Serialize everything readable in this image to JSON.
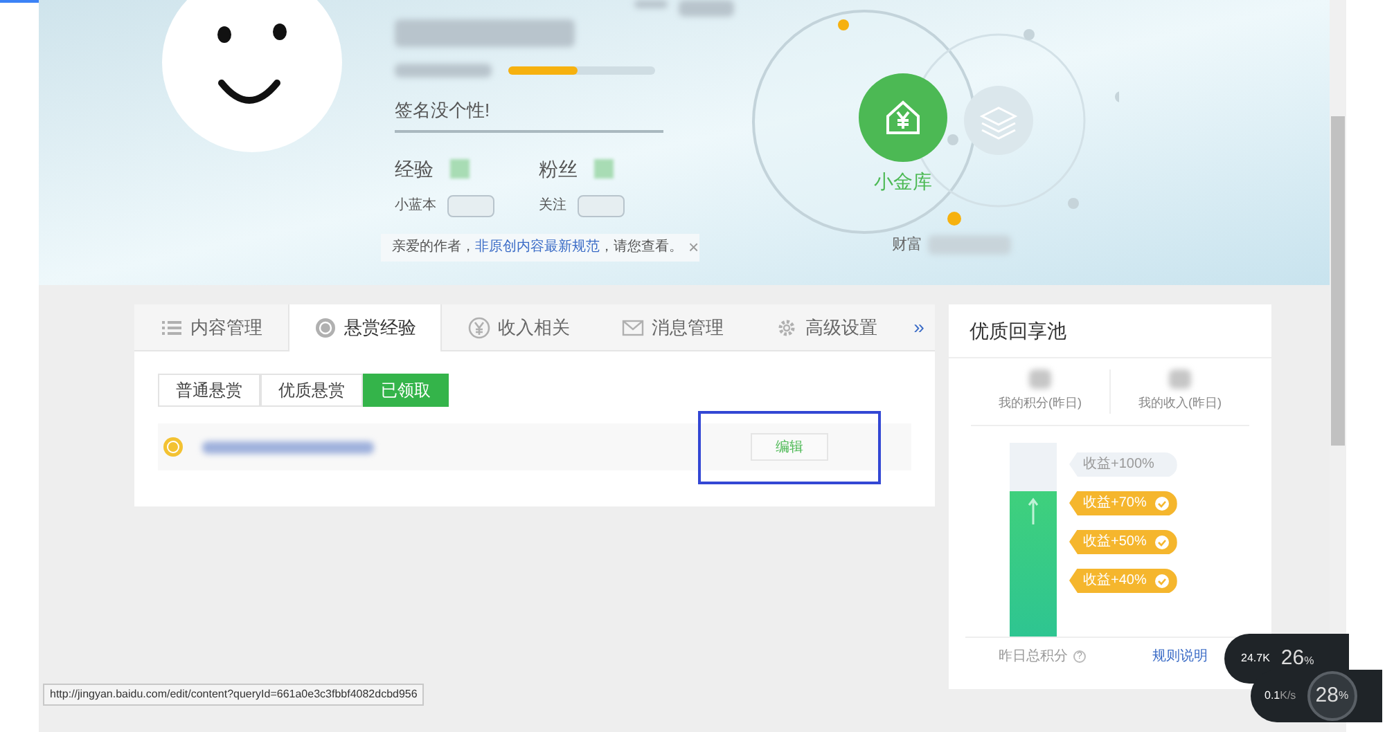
{
  "profile": {
    "signature": "签名没个性!",
    "level_progress": {
      "level": 0.47
    },
    "stats": [
      {
        "label": "经验"
      },
      {
        "label": "粉丝"
      }
    ],
    "sub_stats": [
      {
        "label": "小蓝本"
      },
      {
        "label": "关注"
      }
    ],
    "notice": {
      "text": "亲爱的作者，",
      "link": "非原创内容最新规范",
      "suffix": "，请您查看。",
      "close": "×"
    },
    "vault": {
      "label": "小金库",
      "wealth_label": "财富"
    }
  },
  "tabs": [
    {
      "label": "内容管理",
      "selected": false
    },
    {
      "label": "悬赏经验",
      "selected": true
    },
    {
      "label": "收入相关",
      "selected": false
    },
    {
      "label": "消息管理",
      "selected": false
    },
    {
      "label": "高级设置",
      "selected": false
    }
  ],
  "tabs_more": "»",
  "subtabs": [
    {
      "label": "普通悬赏",
      "selected": false
    },
    {
      "label": "优质悬赏",
      "selected": false
    },
    {
      "label": "已领取",
      "selected": true
    }
  ],
  "rows": [
    {
      "action": "编辑",
      "highlighted": true
    }
  ],
  "pool": {
    "title": "优质回享池",
    "metrics": [
      {
        "label": "我的积分(昨日)"
      },
      {
        "label": "我的收入(昨日)"
      }
    ],
    "fill": {
      "level": 0.75
    },
    "tiers": [
      {
        "label": "收益+100%",
        "reached": false
      },
      {
        "label": "收益+70%",
        "reached": true
      },
      {
        "label": "收益+50%",
        "reached": true
      },
      {
        "label": "收益+40%",
        "reached": true
      }
    ],
    "footer_label": "昨日总积分",
    "help": "?",
    "rules_link": "规则说明"
  },
  "status_url": "http://jingyan.baidu.com/edit/content?queryId=661a0e3c3fbbf4082dcbd956",
  "net_widget": {
    "up": "24.7",
    "up_unit": "K",
    "cpu": "26",
    "down": "0.1",
    "down_unit": "K/s",
    "mem": "28",
    "pct": "%"
  }
}
